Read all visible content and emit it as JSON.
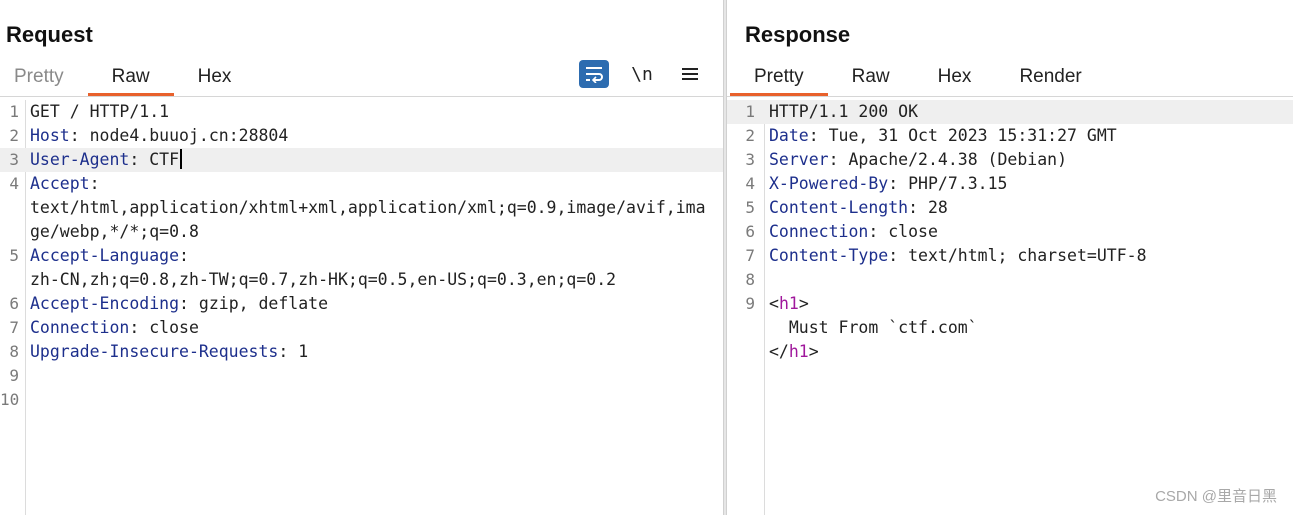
{
  "request": {
    "title": "Request",
    "tabs": [
      "Pretty",
      "Raw",
      "Hex"
    ],
    "active_tab": "Raw",
    "toolbar": {
      "wrap_icon": "wrap-lines-icon",
      "newline_label": "\\n",
      "menu_icon": "hamburger-menu-icon",
      "wrap_color": "#2d6cb0"
    },
    "lines": [
      {
        "n": "1",
        "key": "",
        "sep": "",
        "val": "GET / HTTP/1.1"
      },
      {
        "n": "2",
        "key": "Host",
        "sep": ": ",
        "val": "node4.buuoj.cn:28804"
      },
      {
        "n": "3",
        "key": "User-Agent",
        "sep": ": ",
        "val": "CTF"
      },
      {
        "n": "4",
        "key": "Accept",
        "sep": ":",
        "val": "\ntext/html,application/xhtml+xml,application/xml;q=0.9,image/avif,image/webp,*/*;q=0.8"
      },
      {
        "n": "5",
        "key": "Accept-Language",
        "sep": ":",
        "val": "\nzh-CN,zh;q=0.8,zh-TW;q=0.7,zh-HK;q=0.5,en-US;q=0.3,en;q=0.2"
      },
      {
        "n": "6",
        "key": "Accept-Encoding",
        "sep": ": ",
        "val": "gzip, deflate"
      },
      {
        "n": "7",
        "key": "Connection",
        "sep": ": ",
        "val": "close"
      },
      {
        "n": "8",
        "key": "Upgrade-Insecure-Requests",
        "sep": ": ",
        "val": "1"
      },
      {
        "n": "9",
        "key": "",
        "sep": "",
        "val": ""
      },
      {
        "n": "10",
        "key": "",
        "sep": "",
        "val": ""
      }
    ]
  },
  "response": {
    "title": "Response",
    "tabs": [
      "Pretty",
      "Raw",
      "Hex",
      "Render"
    ],
    "active_tab": "Pretty",
    "lines": [
      {
        "n": "1",
        "key": "",
        "sep": "",
        "val": "HTTP/1.1 200 OK"
      },
      {
        "n": "2",
        "key": "Date",
        "sep": ": ",
        "val": "Tue, 31 Oct 2023 15:31:27 GMT"
      },
      {
        "n": "3",
        "key": "Server",
        "sep": ": ",
        "val": "Apache/2.4.38 (Debian)"
      },
      {
        "n": "4",
        "key": "X-Powered-By",
        "sep": ": ",
        "val": "PHP/7.3.15"
      },
      {
        "n": "5",
        "key": "Content-Length",
        "sep": ": ",
        "val": "28"
      },
      {
        "n": "6",
        "key": "Connection",
        "sep": ": ",
        "val": "close"
      },
      {
        "n": "7",
        "key": "Content-Type",
        "sep": ": ",
        "val": "text/html; charset=UTF-8"
      },
      {
        "n": "8",
        "key": "",
        "sep": "",
        "val": ""
      },
      {
        "n": "9",
        "key": "",
        "sep": "",
        "val": ""
      }
    ],
    "html_body": {
      "open_lt": "<",
      "open_tag": "h1",
      "open_gt": ">",
      "text": "  Must From `ctf.com`",
      "close_lt": "</",
      "close_tag": "h1",
      "close_gt": ">"
    }
  },
  "watermark": "CSDN @里音日黑",
  "colors": {
    "accent": "#e8612c",
    "header_key": "#1d2f8c",
    "html_tag": "#a0189c"
  }
}
